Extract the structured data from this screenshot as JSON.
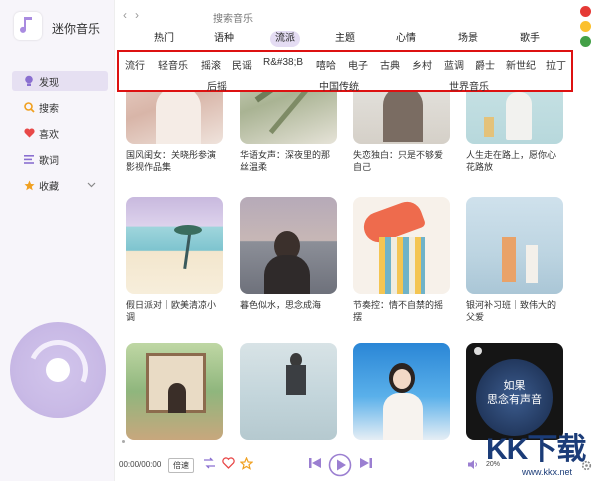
{
  "app": {
    "title": "迷你音乐"
  },
  "nav": [
    {
      "label": "发现",
      "icon": "lightbulb-icon",
      "active": true
    },
    {
      "label": "搜索",
      "icon": "search-icon"
    },
    {
      "label": "喜欢",
      "icon": "heart-icon"
    },
    {
      "label": "歌词",
      "icon": "lyrics-icon"
    },
    {
      "label": "收藏",
      "icon": "star-icon",
      "expandable": true
    }
  ],
  "search": {
    "placeholder": "搜索音乐"
  },
  "tabs": [
    "热门",
    "语种",
    "流派",
    "主题",
    "心情",
    "场景",
    "歌手"
  ],
  "active_tab": "流派",
  "genres_row1": [
    "流行",
    "轻音乐",
    "摇滚",
    "民谣",
    "R&#38;B",
    "嘻哈",
    "电子",
    "古典",
    "乡村",
    "蓝调",
    "爵士",
    "新世纪",
    "拉丁"
  ],
  "genres_row2": [
    "后摇",
    "中国传统",
    "世界音乐"
  ],
  "cards": [
    {
      "caption": "国风闺女：关晓彤参演影视作品集"
    },
    {
      "caption": "华语女声：深夜里的那丝温柔"
    },
    {
      "caption": "失恋独白：只是不够爱自己"
    },
    {
      "caption": "人生走在路上，愿你心花路放"
    },
    {
      "caption": "假日派对｜欧美清凉小调"
    },
    {
      "caption": "暮色似水，思念成海"
    },
    {
      "caption": "节奏控：情不自禁的摇摆"
    },
    {
      "caption": "银河补习班｜致伟大的父爱"
    },
    {
      "caption": ""
    },
    {
      "caption": ""
    },
    {
      "caption": ""
    },
    {
      "caption": "",
      "overlay": "如果\n思念有声音"
    }
  ],
  "player": {
    "time": "00:00/00:00",
    "speed": "倍速",
    "volume": "20%"
  },
  "watermark": {
    "big": "KK下载",
    "url": "www.kkx.net"
  },
  "colors": {
    "accent": "#9b7fd1",
    "highlight_box": "#dd1111",
    "traffic": [
      "#e53935",
      "#fbc02d",
      "#43a047"
    ]
  }
}
